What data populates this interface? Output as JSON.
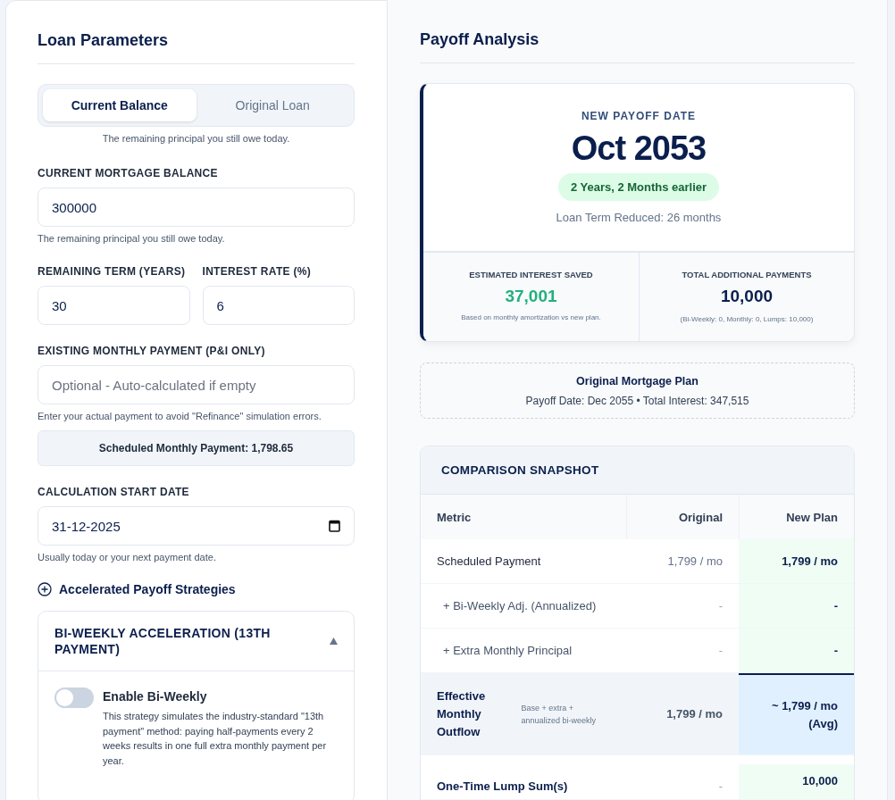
{
  "loan_parameters": {
    "title": "Loan Parameters",
    "mode_tabs": [
      {
        "label": "Current Balance",
        "selected": true
      },
      {
        "label": "Original Loan",
        "selected": false
      }
    ],
    "mode_hint": "The remaining principal you still owe today.",
    "balance": {
      "label": "CURRENT MORTGAGE BALANCE",
      "value": "300000",
      "hint": "The remaining principal you still owe today."
    },
    "term": {
      "label": "REMAINING TERM (YEARS)",
      "value": "30"
    },
    "rate": {
      "label": "INTEREST RATE (%)",
      "value": "6"
    },
    "existing_payment": {
      "label": "EXISTING MONTHLY PAYMENT (P&I ONLY)",
      "placeholder": "Optional - Auto-calculated if empty",
      "hint": "Enter your actual payment to avoid \"Refinance\" simulation errors."
    },
    "scheduled_payment": "Scheduled Monthly Payment: 1,798.65",
    "start_date": {
      "label": "CALCULATION START DATE",
      "value": "31-12-2025",
      "hint": "Usually today or your next payment date."
    },
    "strategies": {
      "title": "Accelerated Payoff Strategies"
    },
    "biweekly": {
      "title": "BI-WEEKLY ACCELERATION (13TH PAYMENT)",
      "expanded": true,
      "toggle_label": "Enable Bi-Weekly",
      "on": false,
      "description": "This strategy simulates the industry-standard \"13th payment\" method: paying half-payments every 2 weeks results in one full extra monthly payment per year."
    }
  },
  "payoff_analysis": {
    "title": "Payoff Analysis",
    "payoff_card": {
      "label": "NEW PAYOFF DATE",
      "date": "Oct 2053",
      "badge": "2 Years, 2 Months earlier",
      "subtitle": "Loan Term Reduced: 26 months",
      "stats": [
        {
          "kind": "savings",
          "label": "ESTIMATED INTEREST SAVED",
          "value": "37,001",
          "note": "Based on monthly amortization vs new plan."
        },
        {
          "kind": "total",
          "label": "TOTAL ADDITIONAL PAYMENTS",
          "value": "10,000",
          "note": "(Bi-Weekly: 0, Monthly: 0, Lumps: 10,000)"
        }
      ]
    },
    "original_plan": {
      "title": "Original Mortgage Plan",
      "details": "Payoff Date: Dec 2055 • Total Interest: 347,515"
    },
    "comparison": {
      "title": "COMPARISON SNAPSHOT",
      "columns": [
        "Metric",
        "Original",
        "New Plan"
      ],
      "rows": [
        {
          "kind": "main",
          "metric": "Scheduled Payment",
          "original": "1,799 / mo",
          "new_plan": "1,799 / mo"
        },
        {
          "kind": "sub",
          "metric": "+ Bi-Weekly Adj. (Annualized)",
          "original": "-",
          "new_plan": "-"
        },
        {
          "kind": "sub",
          "metric": "+ Extra Monthly Principal",
          "original": "-",
          "new_plan": "-"
        },
        {
          "kind": "total",
          "metric": "Effective Monthly Outflow",
          "note": "Base + extra + annualized bi-weekly",
          "original": "1,799 / mo",
          "new_plan": "~ 1,799 / mo (Avg)"
        },
        {
          "kind": "lump",
          "metric": "One-Time Lump Sum(s)",
          "original": "-",
          "new_plan": "10,000"
        }
      ]
    }
  }
}
